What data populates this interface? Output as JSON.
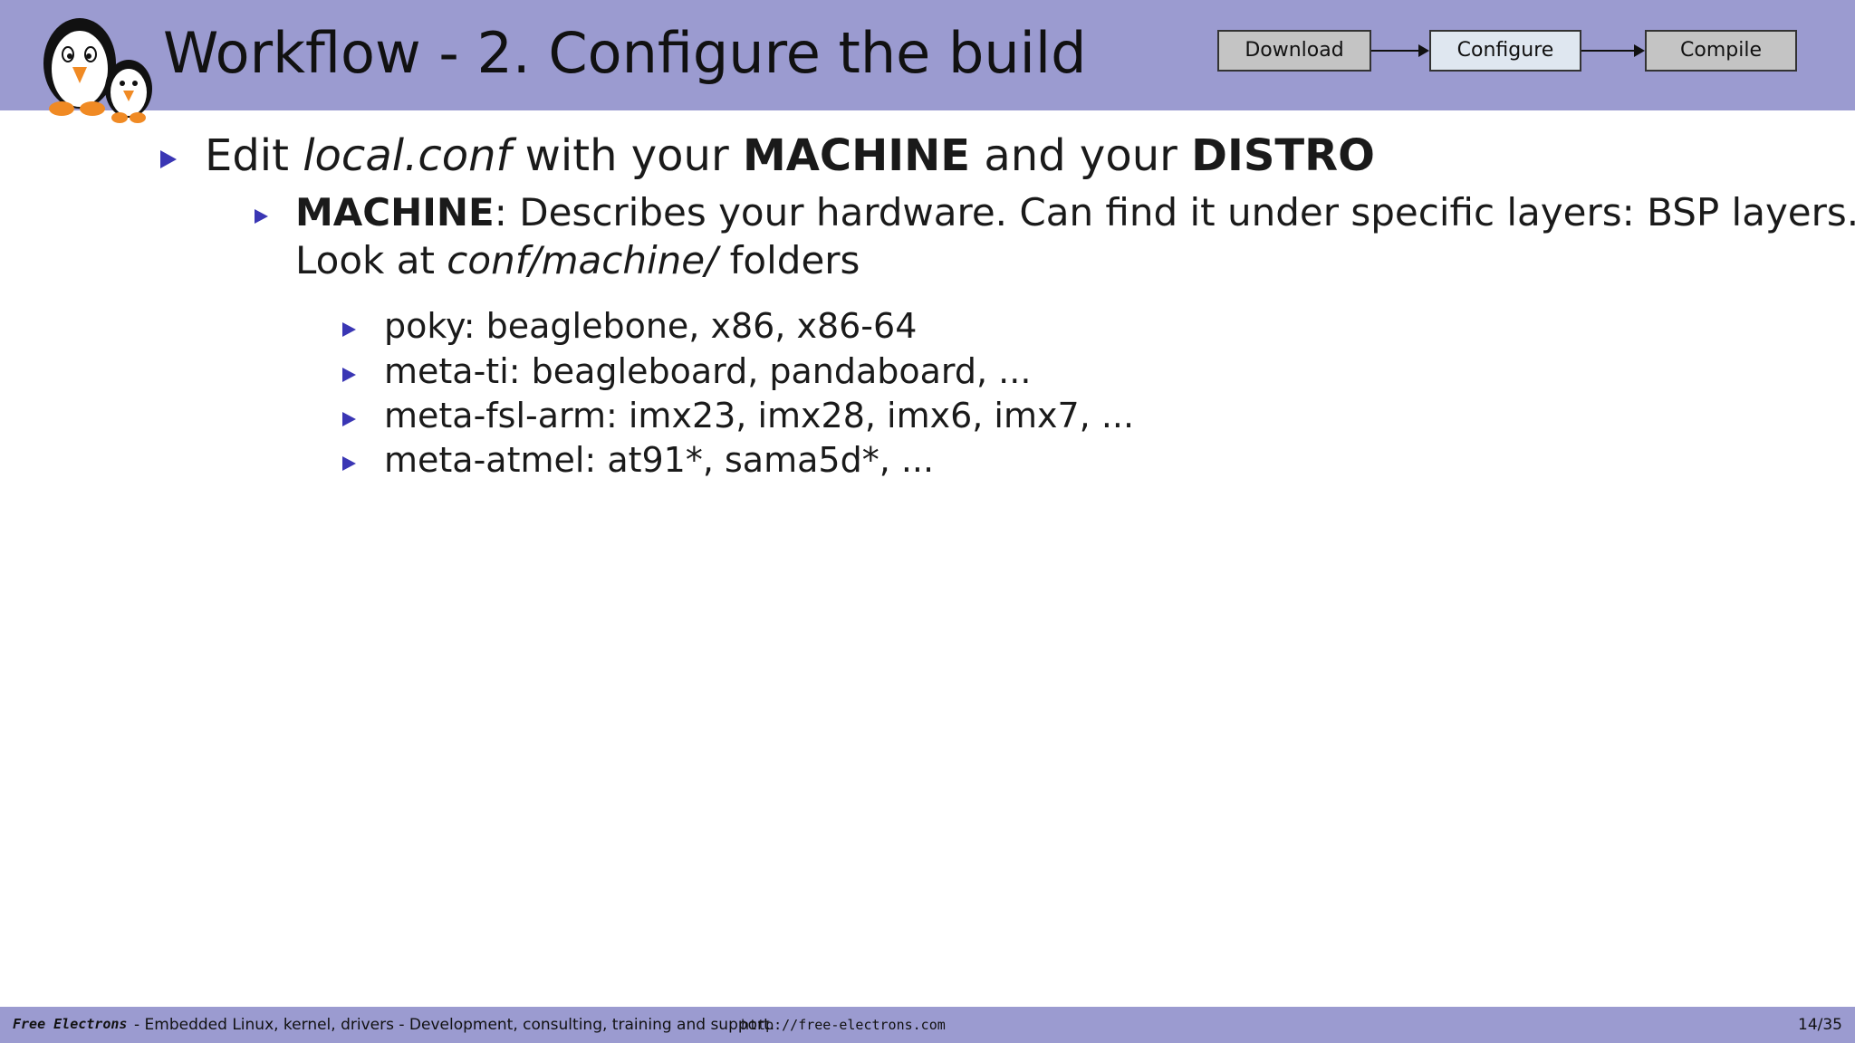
{
  "header": {
    "title": "Workflow - 2.  Configure the build",
    "steps": [
      {
        "label": "Download",
        "state": "inactive"
      },
      {
        "label": "Configure",
        "state": "active"
      },
      {
        "label": "Compile",
        "state": "inactive"
      }
    ]
  },
  "content": {
    "item1": {
      "prefix": "Edit ",
      "file": "local.conf",
      "mid": " with your ",
      "machine": "MACHINE",
      "and": " and your ",
      "distro": "DISTRO"
    },
    "item2": {
      "term": "MACHINE",
      "line1_rest": ": Describes your hardware.  Can find it under specific layers:  BSP layers.",
      "line2_prefix": "Look at ",
      "line2_path": "conf/machine/",
      "line2_suffix": " folders"
    },
    "sub_items": [
      "poky:  beaglebone, x86, x86-64",
      "meta-ti:  beagleboard, pandaboard, ...",
      "meta-fsl-arm:  imx23, imx28, imx6, imx7, ...",
      "meta-atmel:  at91*, sama5d*, ..."
    ]
  },
  "footer": {
    "brand": "Free Electrons",
    "description": "- Embedded Linux, kernel, drivers - Development, consulting, training and support.",
    "url": "http://free-electrons.com",
    "page": "14/35"
  },
  "colors": {
    "header_bg": "#9b9bd0",
    "bullet": "#3a36b4",
    "active_step": "#dfe7f0",
    "inactive_step": "#c4c4c4"
  }
}
